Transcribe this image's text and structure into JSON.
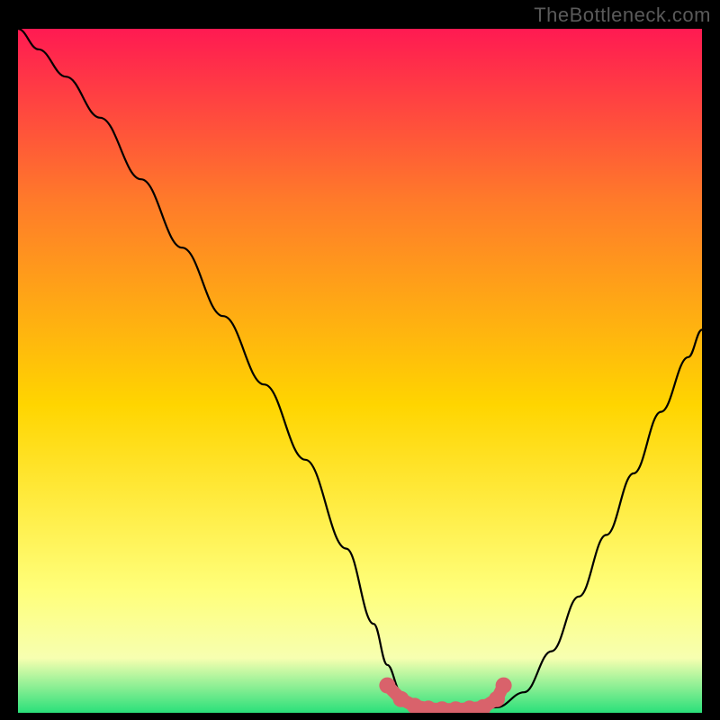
{
  "watermark": "TheBottleneck.com",
  "colors": {
    "frame_bg": "#000000",
    "gradient_top": "#ff1a52",
    "gradient_mid1": "#ff7a2a",
    "gradient_mid2": "#ffd500",
    "gradient_low": "#ffff7a",
    "gradient_band": "#f7ffb0",
    "gradient_green": "#2ae07a",
    "curve_stroke": "#000000",
    "marker_fill": "#d9626b",
    "marker_stroke": "#d9626b"
  },
  "chart_data": {
    "type": "line",
    "title": "",
    "xlabel": "",
    "ylabel": "",
    "xlim": [
      0,
      100
    ],
    "ylim": [
      0,
      100
    ],
    "series": [
      {
        "name": "bottleneck-curve",
        "x": [
          0,
          3,
          7,
          12,
          18,
          24,
          30,
          36,
          42,
          48,
          52,
          54,
          56,
          58,
          60,
          63,
          66,
          70,
          74,
          78,
          82,
          86,
          90,
          94,
          98,
          100
        ],
        "y": [
          100,
          97,
          93,
          87,
          78,
          68,
          58,
          48,
          37,
          24,
          13,
          7,
          3,
          1,
          0.5,
          0.5,
          0.5,
          0.8,
          3,
          9,
          17,
          26,
          35,
          44,
          52,
          56
        ]
      }
    ],
    "markers": {
      "name": "optimal-region",
      "x": [
        54,
        56,
        58,
        60,
        62,
        64,
        66,
        68,
        70,
        71
      ],
      "y": [
        4,
        2,
        1,
        0.6,
        0.5,
        0.5,
        0.6,
        0.8,
        2,
        4
      ]
    }
  }
}
